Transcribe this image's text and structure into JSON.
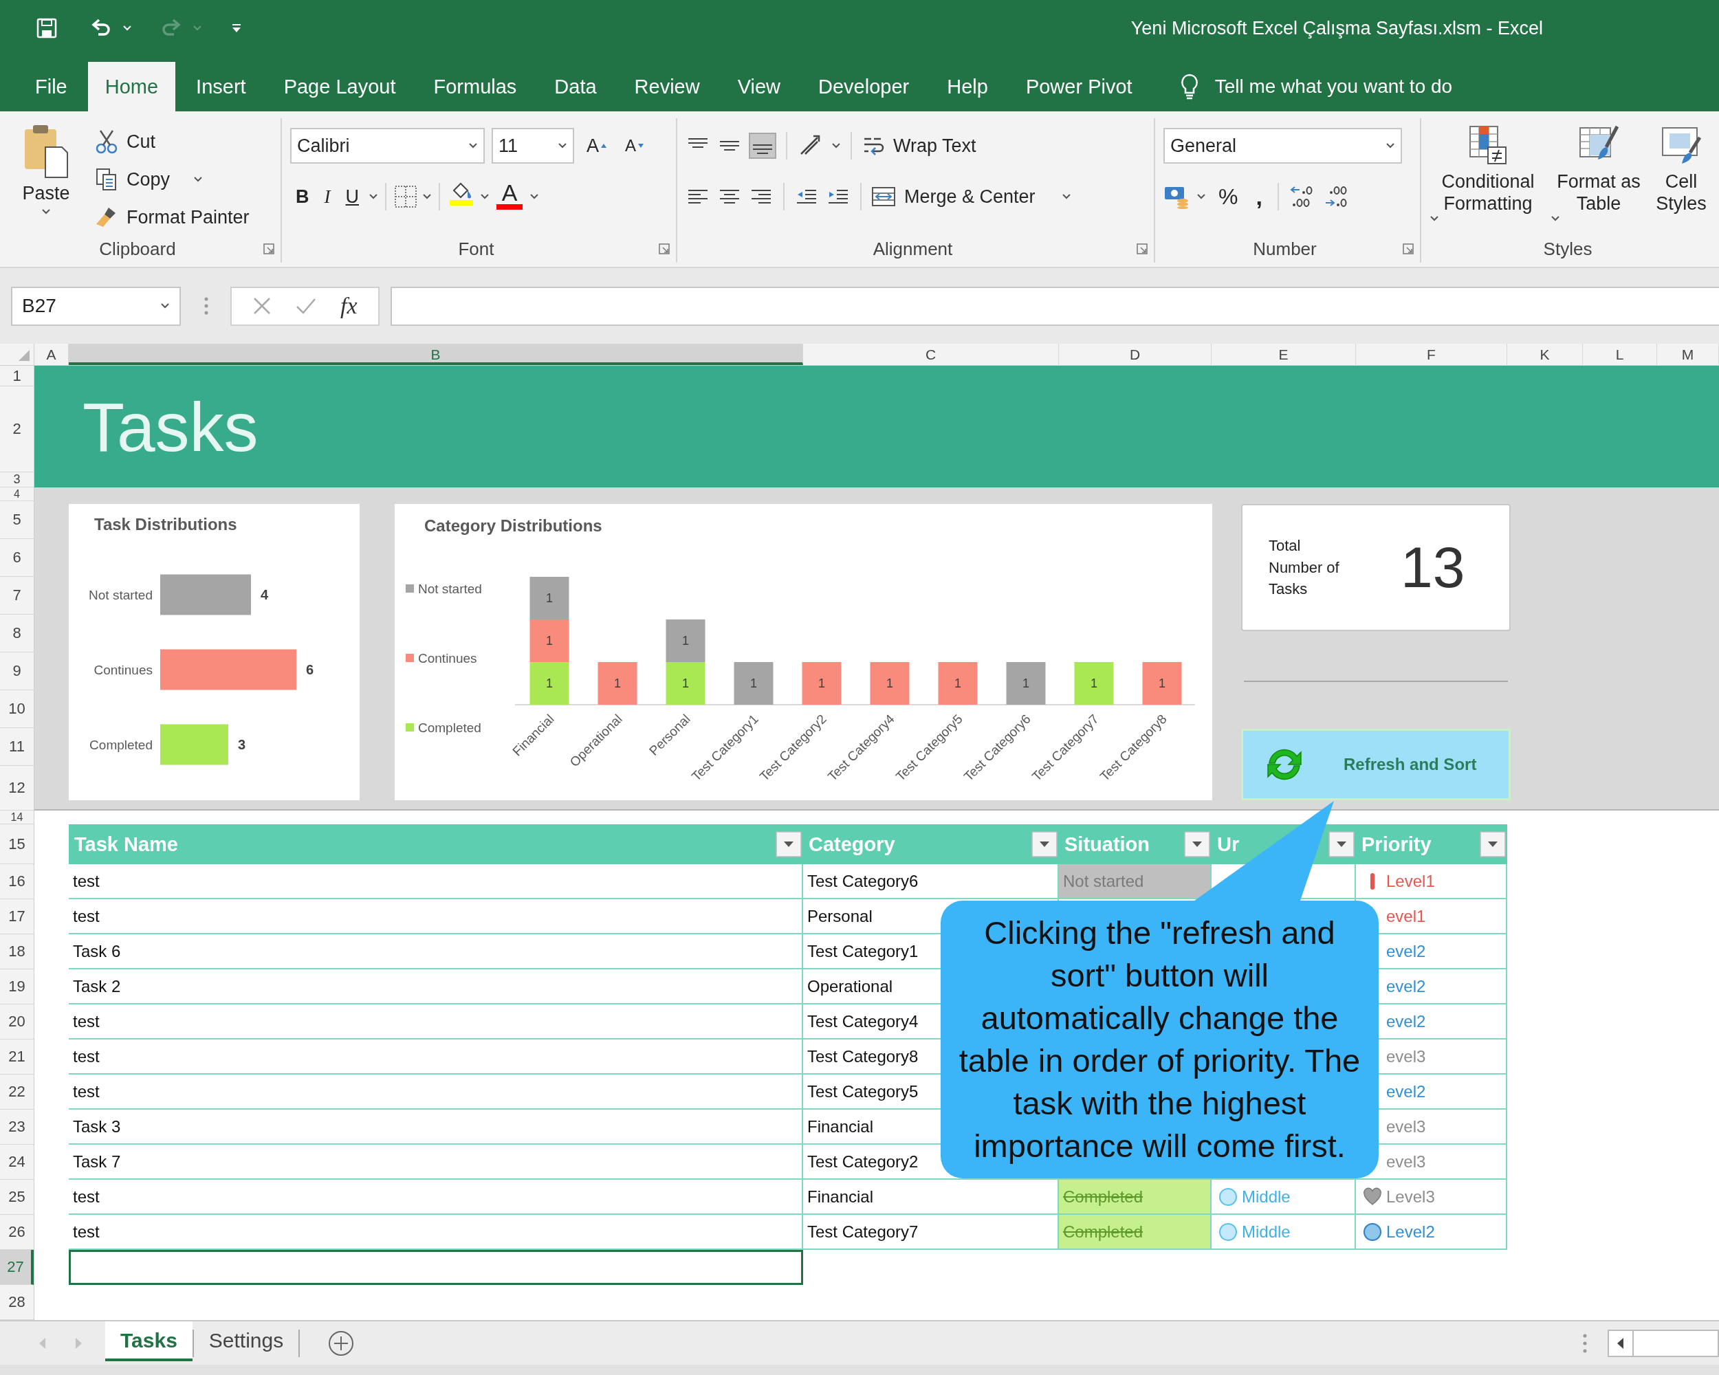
{
  "title_bar": {
    "title": "Yeni Microsoft Excel Çalışma Sayfası.xlsm - Excel"
  },
  "ribbon_tabs": [
    {
      "label": "File",
      "selected": false
    },
    {
      "label": "Home",
      "selected": true
    },
    {
      "label": "Insert",
      "selected": false
    },
    {
      "label": "Page Layout",
      "selected": false
    },
    {
      "label": "Formulas",
      "selected": false
    },
    {
      "label": "Data",
      "selected": false
    },
    {
      "label": "Review",
      "selected": false
    },
    {
      "label": "View",
      "selected": false
    },
    {
      "label": "Developer",
      "selected": false
    },
    {
      "label": "Help",
      "selected": false
    },
    {
      "label": "Power Pivot",
      "selected": false
    }
  ],
  "tell_me": {
    "placeholder": "Tell me what you want to do"
  },
  "ribbon": {
    "clipboard": {
      "paste": "Paste",
      "cut": "Cut",
      "copy": "Copy",
      "format_painter": "Format Painter",
      "label": "Clipboard"
    },
    "font": {
      "font_name": "Calibri",
      "font_size": "11",
      "grow_font": "A",
      "shrink_font": "A",
      "bold": "B",
      "italic": "I",
      "underline": "U",
      "font_color": "A",
      "label": "Font"
    },
    "alignment": {
      "wrap_text": "Wrap Text",
      "merge_center": "Merge & Center",
      "label": "Alignment"
    },
    "number": {
      "format": "General",
      "percent": "%",
      "comma": ",",
      "label": "Number"
    },
    "styles": {
      "conditional_formatting": "Conditional Formatting",
      "format_as_table": "Format as Table",
      "cell_styles": "Cell Styles",
      "label": "Styles"
    }
  },
  "formula_bar": {
    "name_box": "B27",
    "fx": "fx"
  },
  "columns": [
    {
      "label": "A",
      "selected": false
    },
    {
      "label": "B",
      "selected": true
    },
    {
      "label": "C",
      "selected": false
    },
    {
      "label": "D",
      "selected": false
    },
    {
      "label": "E",
      "selected": false
    },
    {
      "label": "F",
      "selected": false
    },
    {
      "label": "K",
      "selected": false
    },
    {
      "label": "L",
      "selected": false
    },
    {
      "label": "M",
      "selected": false
    }
  ],
  "rows": [
    {
      "label": "1",
      "selected": false
    },
    {
      "label": "2",
      "selected": false
    },
    {
      "label": "3",
      "selected": false
    },
    {
      "label": "4",
      "selected": false
    },
    {
      "label": "5",
      "selected": false
    },
    {
      "label": "6",
      "selected": false
    },
    {
      "label": "7",
      "selected": false
    },
    {
      "label": "8",
      "selected": false
    },
    {
      "label": "9",
      "selected": false
    },
    {
      "label": "10",
      "selected": false
    },
    {
      "label": "11",
      "selected": false
    },
    {
      "label": "12",
      "selected": false
    },
    {
      "label": "14",
      "selected": false
    },
    {
      "label": "15",
      "selected": false
    },
    {
      "label": "16",
      "selected": false
    },
    {
      "label": "17",
      "selected": false
    },
    {
      "label": "18",
      "selected": false
    },
    {
      "label": "19",
      "selected": false
    },
    {
      "label": "20",
      "selected": false
    },
    {
      "label": "21",
      "selected": false
    },
    {
      "label": "22",
      "selected": false
    },
    {
      "label": "23",
      "selected": false
    },
    {
      "label": "24",
      "selected": false
    },
    {
      "label": "25",
      "selected": false
    },
    {
      "label": "26",
      "selected": false
    },
    {
      "label": "27",
      "selected": true
    },
    {
      "label": "28",
      "selected": false
    }
  ],
  "banner": {
    "title": "Tasks"
  },
  "task_chart": {
    "chart_data": {
      "type": "bar",
      "orientation": "horizontal",
      "title": "Task Distributions",
      "categories": [
        "Not started",
        "Continues",
        "Completed"
      ],
      "stacked": true,
      "data_labels": true,
      "series": [
        {
          "color": "#a5a5a5",
          "values": [
            4,
            null,
            null
          ]
        },
        {
          "color": "#f88b7c",
          "values": [
            null,
            6,
            null
          ]
        },
        {
          "color": "#a9e853",
          "values": [
            null,
            null,
            3
          ]
        }
      ]
    }
  },
  "category_chart": {
    "chart_data": {
      "type": "bar",
      "title": "Category Distributions",
      "categories": [
        "Financial",
        "Operational",
        "Personal",
        "Test Category1",
        "Test Category2",
        "Test Category4",
        "Test Category5",
        "Test Category6",
        "Test Category7",
        "Test Category8"
      ],
      "stacked": true,
      "data_labels": true,
      "legend": "left",
      "series": [
        {
          "name": "Completed",
          "color": "#a9e853",
          "values": [
            1,
            null,
            1,
            null,
            null,
            null,
            null,
            null,
            1,
            null
          ]
        },
        {
          "name": "Continues",
          "color": "#f88b7c",
          "values": [
            1,
            1,
            null,
            null,
            1,
            1,
            1,
            null,
            null,
            1
          ]
        },
        {
          "name": "Not started",
          "color": "#a5a5a5",
          "values": [
            1,
            null,
            1,
            1,
            null,
            null,
            null,
            1,
            null,
            null
          ]
        }
      ]
    }
  },
  "total_card": {
    "label": "Total Number of Tasks",
    "value": "13"
  },
  "refresh_button": {
    "label": "Refresh and Sort"
  },
  "table": {
    "columns": [
      {
        "label": "Task Name"
      },
      {
        "label": "Category"
      },
      {
        "label": "Situation"
      },
      {
        "label": "Ur"
      },
      {
        "label": "Priority"
      }
    ],
    "rows": [
      {
        "task": "test",
        "category": "Test Category6",
        "situation": {
          "text": "Not started",
          "kind": "not_started"
        },
        "priority": {
          "text": "Level1",
          "kind": "level1",
          "icon_visible": true
        }
      },
      {
        "task": "test",
        "category": "Personal",
        "priority": {
          "text": "evel1",
          "kind": "level1",
          "icon_visible": false
        }
      },
      {
        "task": "Task 6",
        "category": "Test Category1",
        "priority": {
          "text": "evel2",
          "kind": "level2",
          "icon_visible": false
        }
      },
      {
        "task": "Task 2",
        "category": "Operational",
        "priority": {
          "text": "evel2",
          "kind": "level2",
          "icon_visible": false
        }
      },
      {
        "task": "test",
        "category": "Test Category4",
        "priority": {
          "text": "evel2",
          "kind": "level2",
          "icon_visible": false
        }
      },
      {
        "task": "test",
        "category": "Test Category8",
        "priority": {
          "text": "evel3",
          "kind": "level3",
          "icon_visible": false
        }
      },
      {
        "task": "test",
        "category": "Test Category5",
        "priority": {
          "text": "evel2",
          "kind": "level2",
          "icon_visible": false
        }
      },
      {
        "task": "Task 3",
        "category": "Financial",
        "priority": {
          "text": "evel3",
          "kind": "level3",
          "icon_visible": false
        }
      },
      {
        "task": "Task 7",
        "category": "Test Category2",
        "priority": {
          "text": "evel3",
          "kind": "level3",
          "icon_visible": false
        }
      },
      {
        "task": "test",
        "category": "Financial",
        "situation": {
          "text": "Completed",
          "kind": "completed"
        },
        "urgency": {
          "text": "Middle",
          "kind": "middle"
        },
        "priority": {
          "text": "Level3",
          "kind": "level3",
          "icon_visible": true
        }
      },
      {
        "task": "test",
        "category": "Test Category7",
        "situation": {
          "text": "Completed",
          "kind": "completed"
        },
        "urgency": {
          "text": "Middle",
          "kind": "middle"
        },
        "priority": {
          "text": "Level2",
          "kind": "level2",
          "icon_visible": true
        }
      }
    ]
  },
  "callout": {
    "text": "Clicking the \"refresh and sort\" button will automatically change the table in order of priority. The task with the highest importance will come first."
  },
  "sheet_tabs": [
    {
      "label": "Tasks",
      "selected": true
    },
    {
      "label": "Settings",
      "selected": false
    }
  ]
}
